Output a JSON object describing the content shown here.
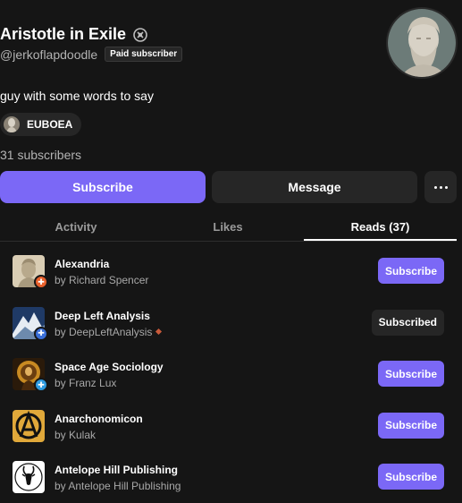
{
  "profile": {
    "name": "Aristotle in Exile",
    "handle": "@jerkoflapdoodle",
    "paid_badge": "Paid subscriber",
    "bio": "guy with some words to say",
    "publication_chip": "EUBOEA",
    "subscribers": "31 subscribers"
  },
  "actions": {
    "subscribe": "Subscribe",
    "message": "Message"
  },
  "tabs": [
    {
      "label": "Activity",
      "active": false
    },
    {
      "label": "Likes",
      "active": false
    },
    {
      "label": "Reads (37)",
      "active": true
    }
  ],
  "reads": [
    {
      "title": "Alexandria",
      "author": "by Richard Spencer",
      "button": "Subscribe",
      "subscribed": false,
      "badge_color": "#e8602c"
    },
    {
      "title": "Deep Left Analysis",
      "author": "by DeepLeftAnalysis",
      "button": "Subscribed",
      "subscribed": true,
      "badge_color": "#3a6fd8"
    },
    {
      "title": "Space Age Sociology",
      "author": "by Franz Lux",
      "button": "Subscribe",
      "subscribed": false,
      "badge_color": "#2e9be0"
    },
    {
      "title": "Anarchonomicon",
      "author": "by Kulak",
      "button": "Subscribe",
      "subscribed": false
    },
    {
      "title": "Antelope Hill Publishing",
      "author": "by Antelope Hill Publishing",
      "button": "Subscribe",
      "subscribed": false
    }
  ],
  "colors": {
    "accent": "#7b68f6",
    "background": "#151515",
    "surface": "#262626"
  }
}
